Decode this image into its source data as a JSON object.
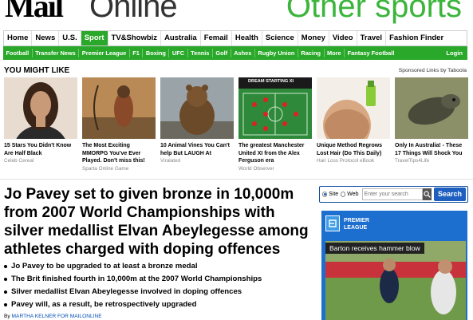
{
  "header": {
    "logo": "Mail",
    "logo_online": "Online",
    "section_title": "Other sports"
  },
  "nav": [
    "Home",
    "News",
    "U.S.",
    "Sport",
    "TV&Showbiz",
    "Australia",
    "Femail",
    "Health",
    "Science",
    "Money",
    "Video",
    "Travel",
    "Fashion Finder"
  ],
  "nav_active": "Sport",
  "subnav": [
    "Football",
    "Transfer News",
    "Premier League",
    "F1",
    "Boxing",
    "UFC",
    "Tennis",
    "Golf",
    "Ashes",
    "Rugby Union",
    "Racing",
    "More",
    "Fantasy Football"
  ],
  "subnav_login": "Login",
  "you_might_like": {
    "title": "YOU MIGHT LIKE",
    "sponsor": "Sponsored Links by Taboola",
    "cards": [
      {
        "title": "15 Stars You Didn't Know Are Half Black",
        "source": "Celeb Cereal"
      },
      {
        "title": "The Most Exciting MMORPG You've Ever Played. Don't miss this!",
        "source": "Sparta Online Game"
      },
      {
        "title": "10 Animal Vines You Can't help But LAUGH At",
        "source": "Viralated"
      },
      {
        "title": "The greatest Manchester United XI from the Alex Ferguson era",
        "source": "World Observer",
        "img_text": "DREAM STARTING XI"
      },
      {
        "title": "Unique Method Regrows Lost Hair (Do This Daily)",
        "source": "Hair Loss Protocol eBook"
      },
      {
        "title": "Only In Australia! - These 17 Things Will Shock You",
        "source": "TravelTips4Life"
      }
    ]
  },
  "article": {
    "headline": "Jo Pavey set to given bronze in 10,000m from 2007 World Championships with silver medallist Elvan Abeylegesse among athletes charged with doping offences",
    "bullets": [
      "Jo Pavey to be upgraded to at least a bronze medal",
      "The Brit finished fourth in 10,000m at the 2007 World Championships",
      "Silver medallist Elvan Abeylegesse involved in doping offences",
      "Pavey will, as a result, be retrospectively upgraded"
    ],
    "byline_prefix": "By",
    "byline_author": "MARTHA KELNER FOR MAILONLINE"
  },
  "search": {
    "option_site": "Site",
    "option_web": "Web",
    "placeholder": "Enter your search",
    "button": "Search"
  },
  "premier_league": {
    "label_line1": "PREMIER",
    "label_line2": "LEAGUE",
    "caption": "Barton receives hammer blow"
  },
  "colors": {
    "sport_green": "#2aa82a",
    "search_blue": "#1f5fbf",
    "pl_blue": "#1d6fcf"
  }
}
